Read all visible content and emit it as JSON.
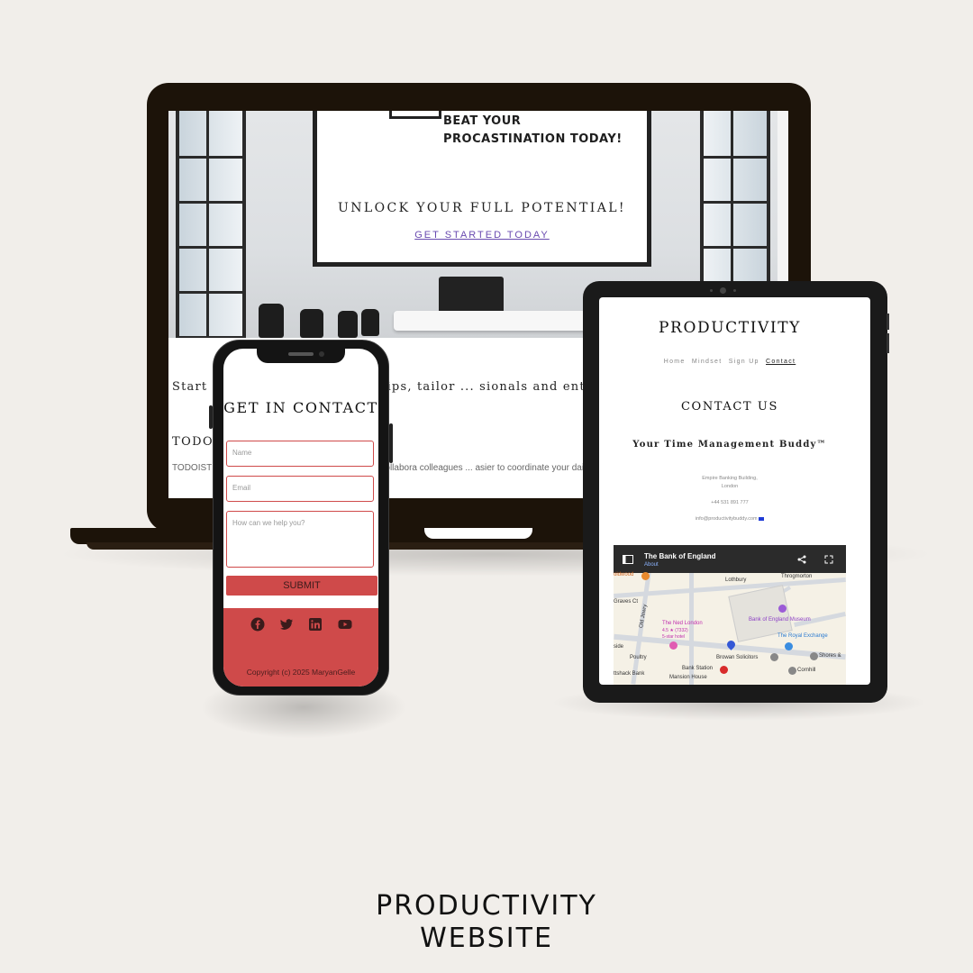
{
  "laptop": {
    "hero": {
      "board_text": "BEAT YOUR PROCASTINATION TODAY!",
      "headline": "UNLOCK YOUR FULL POTENTIAL!",
      "cta": "GET STARTED TODAY"
    },
    "intro": "Start ... ney with personlized tips, tailor ... sionals and entrepreneur with",
    "todo_title": "TODO ... Tool",
    "todo_desc": "TODOIST ... ou can monitor your own progress and collabora colleagues ... asier to coordinate your daily tasks."
  },
  "phone": {
    "title": "GET IN CONTACT",
    "name_placeholder": "Name",
    "email_placeholder": "Email",
    "message_placeholder": "How can we help you?",
    "submit": "SUBMIT",
    "social_icons": [
      "facebook-icon",
      "twitter-icon",
      "linkedin-icon",
      "youtube-icon"
    ],
    "copyright": "Copyright (c) 2025 MaryanGelle",
    "accent": "#cf4a4a"
  },
  "tablet": {
    "brand": "PRODUCTIVITY",
    "nav": [
      "Home",
      "Mindset",
      "Sign Up",
      "Contact"
    ],
    "active_nav": "Contact",
    "heading": "CONTACT US",
    "tagline": "Your Time Management Buddy™",
    "address_line1": "Empire Banking Building,",
    "address_line2": "London",
    "phone": "+44 531 891 777",
    "email": "info@productivitybuddy.com",
    "map": {
      "title": "The Bank of England",
      "about": "About",
      "labels": [
        "oldwood",
        "Lothbury",
        "Throgmorton",
        "Old Jewry",
        "Graves Ct",
        "The Ned London",
        "4.5 ★ (7332)",
        "5-star hotel",
        "Bank of England Museum",
        "The Royal Exchange",
        "Poultry",
        "Browan Solicitors",
        "Bank Station",
        "Cornhill",
        "Shores &",
        "ttshack Bank",
        "Mansion House",
        "side"
      ]
    }
  },
  "caption": {
    "line1": "PRODUCTIVITY",
    "line2": "WEBSITE"
  }
}
